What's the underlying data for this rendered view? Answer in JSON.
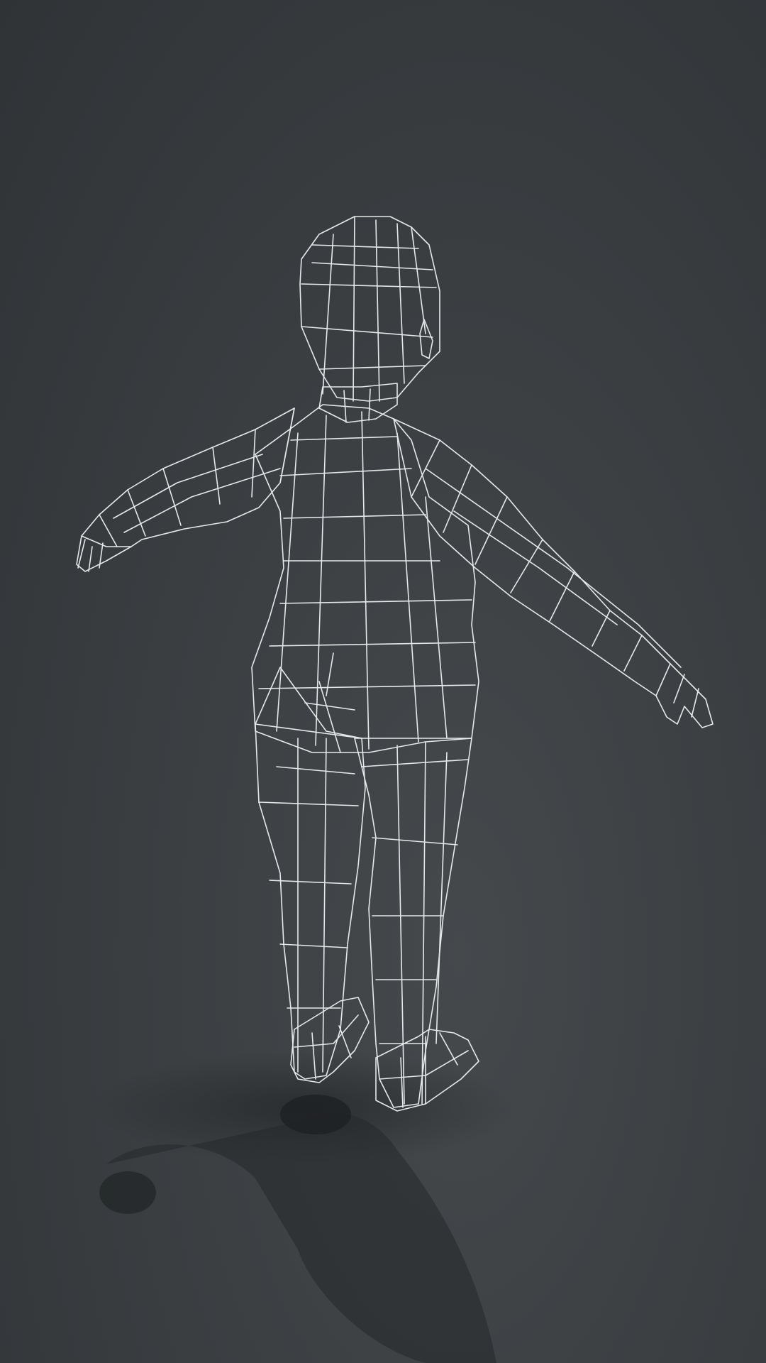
{
  "scene": {
    "description_visible_text": "",
    "colors": {
      "background_top": "#2e3134",
      "background_bottom": "#45494c",
      "mesh_fill": "#30363a",
      "mesh_fill_highlight": "#5a6368",
      "wireframe": "#e6e9ea",
      "shadow": "#1e2123"
    },
    "subject": "low-poly-humanoid-wireframe",
    "pose": "a-pose"
  }
}
